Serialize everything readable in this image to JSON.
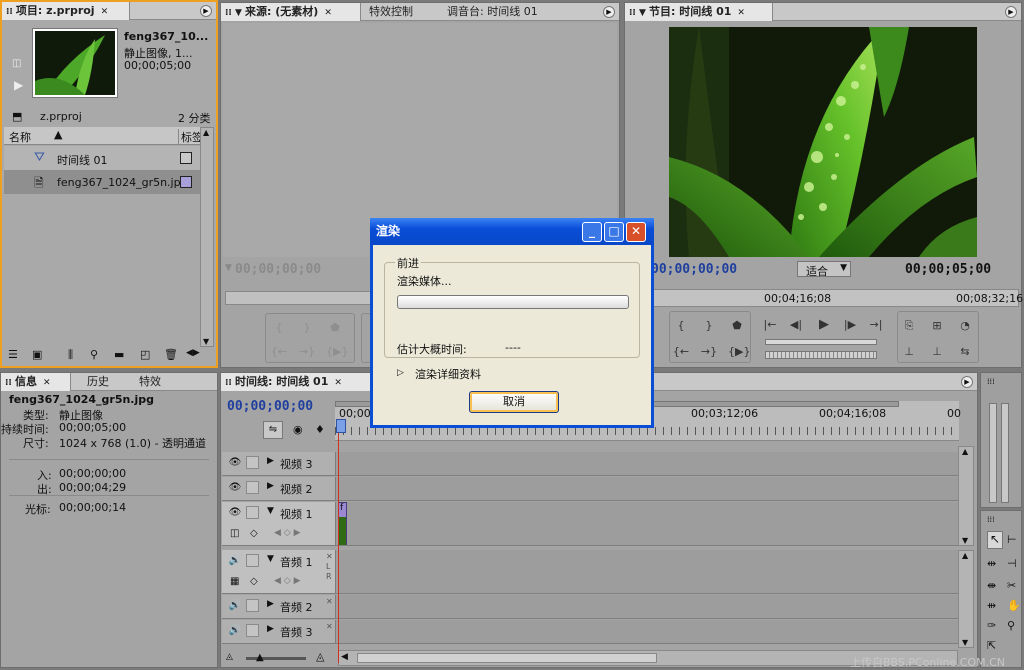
{
  "project_panel": {
    "tab": "项目: z.prproj",
    "clip_name": "feng367_10...",
    "clip_type": "静止图像, 1...",
    "clip_duration": "00;00;05;00",
    "project_file": "z.prproj",
    "item_count": "2 分类",
    "col_name": "名称",
    "col_label": "标签",
    "items": [
      {
        "name": "时间线 01",
        "icon": "sequence-icon"
      },
      {
        "name": "feng367_1024_gr5n.jpg",
        "icon": "image-file-icon"
      }
    ]
  },
  "source_panel": {
    "tabs": [
      "来源: (无素材)",
      "特效控制",
      "调音台: 时间线 01"
    ],
    "timecode": "00;00;00;00"
  },
  "program_panel": {
    "tab": "节目: 时间线 01",
    "timecode_current": "00;00;00;00",
    "fit": "适合",
    "timecode_total": "00;00;05;00",
    "ruler": [
      "00;04;16;08",
      "00;08;32;16"
    ]
  },
  "info_panel": {
    "tabs": [
      "信息",
      "历史",
      "特效"
    ],
    "file": "feng367_1024_gr5n.jpg",
    "lines": [
      {
        "label": "类型:",
        "value": "静止图像"
      },
      {
        "label": "持续时间:",
        "value": "00;00;05;00"
      },
      {
        "label": "尺寸:",
        "value": "1024 x 768 (1.0) - 透明通道"
      }
    ],
    "in_label": "入:",
    "in_value": "00;00;00;00",
    "out_label": "出:",
    "out_value": "00;00;04;29",
    "cursor_label": "光标:",
    "cursor_value": "00;00;00;14"
  },
  "timeline_panel": {
    "tab": "时间线: 时间线 01",
    "timecode": "00;00;00;00",
    "ruler": [
      "00;00",
      "00;03;12;06",
      "00;04;16;08",
      "00"
    ],
    "video_tracks": [
      "视频 3",
      "视频 2",
      "视频 1"
    ],
    "audio_tracks": [
      "音频 1",
      "音频 2",
      "音频 3"
    ],
    "clip_label": "f"
  },
  "render_dialog": {
    "title": "渲染",
    "group_label": "前进",
    "status": "渲染媒体...",
    "progress": 0,
    "estimate_label": "估计大概时间:",
    "estimate_value": "----",
    "details": "渲染详细资料",
    "cancel": "取消"
  },
  "watermark": "上传自BBS.PConline.COM.CN"
}
